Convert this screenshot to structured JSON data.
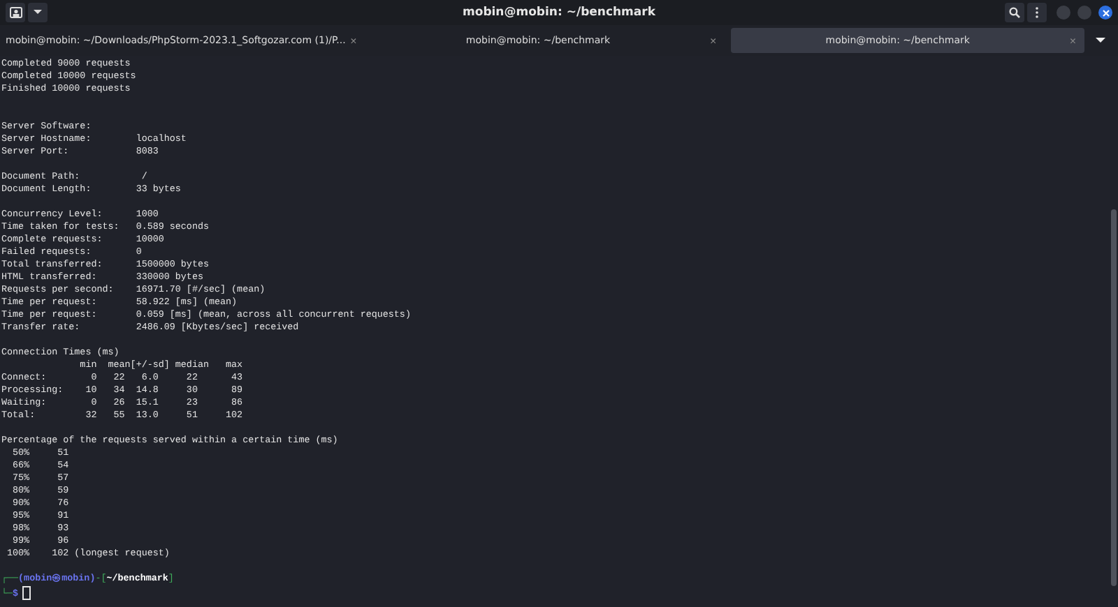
{
  "window": {
    "title": "mobin@mobin: ~/benchmark"
  },
  "tabs": [
    {
      "label": "mobin@mobin: ~/Downloads/PhpStorm-2023.1_Softgozar.com (1)/P...",
      "close": "×",
      "selected": false
    },
    {
      "label": "mobin@mobin: ~/benchmark",
      "close": "×",
      "selected": false
    },
    {
      "label": "mobin@mobin: ~/benchmark",
      "close": "×",
      "selected": true
    }
  ],
  "output": [
    [
      "Completed 9000 requests",
      "Completed 10000 requests",
      "Finished 10000 requests"
    ],
    [
      "Server Software:",
      "Server Hostname:        localhost",
      "Server Port:            8083"
    ],
    [
      "Document Path:           /",
      "Document Length:        33 bytes"
    ],
    [
      "Concurrency Level:      1000",
      "Time taken for tests:   0.589 seconds",
      "Complete requests:      10000",
      "Failed requests:        0",
      "Total transferred:      1500000 bytes",
      "HTML transferred:       330000 bytes",
      "Requests per second:    16971.70 [#/sec] (mean)",
      "Time per request:       58.922 [ms] (mean)",
      "Time per request:       0.059 [ms] (mean, across all concurrent requests)",
      "Transfer rate:          2486.09 [Kbytes/sec] received"
    ],
    [
      "Connection Times (ms)",
      "              min  mean[+/-sd] median   max",
      "Connect:        0   22   6.0     22      43",
      "Processing:    10   34  14.8     30      89",
      "Waiting:        0   26  15.1     23      86",
      "Total:         32   55  13.0     51     102"
    ],
    [
      "Percentage of the requests served within a certain time (ms)",
      "  50%     51",
      "  66%     54",
      "  75%     57",
      "  80%     59",
      "  90%     76",
      "  95%     91",
      "  98%     93",
      "  99%     96",
      " 100%    102 (longest request)"
    ]
  ],
  "prompt": {
    "corner_top": "┌──",
    "user": "(mobin㉿mobin)",
    "open": "-[",
    "path": "~/benchmark",
    "close": "]",
    "corner_bottom": "└─",
    "symbol": "$"
  }
}
